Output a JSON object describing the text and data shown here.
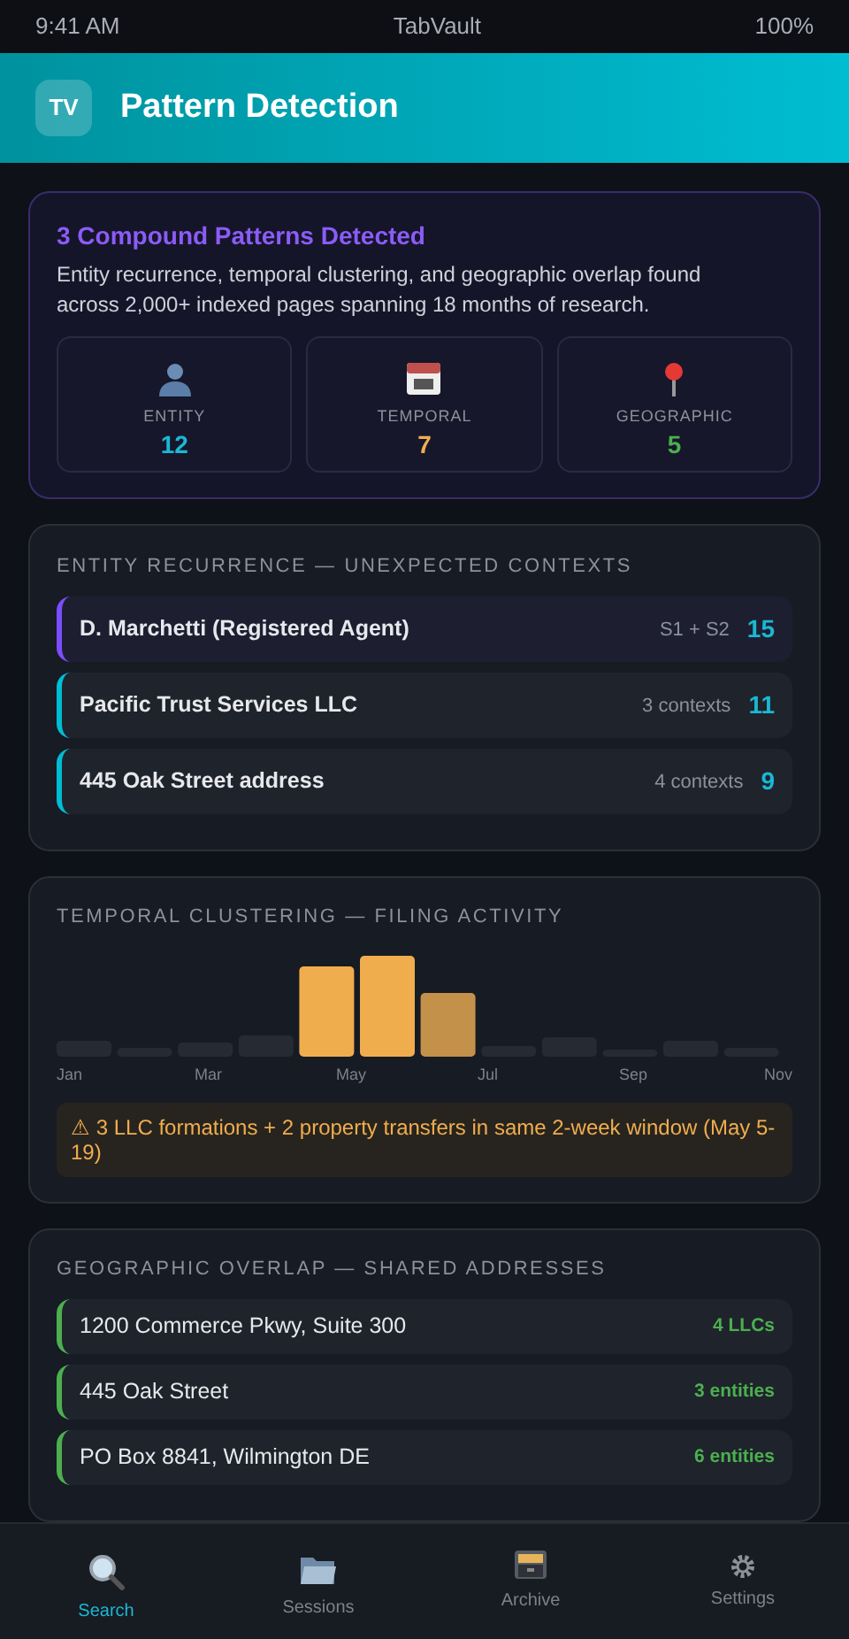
{
  "status_bar": {
    "time": "9:41 AM",
    "app": "TabVault",
    "battery": "100%"
  },
  "header": {
    "logo": "TV",
    "title": "Pattern Detection"
  },
  "summary": {
    "title": "3 Compound Patterns Detected",
    "description": "Entity recurrence, temporal clustering, and geographic overlap found across 2,000+ indexed pages spanning 18 months of research.",
    "stats": [
      {
        "kind": "entity",
        "label": "ENTITY",
        "value": "12",
        "color": "#1ab8d4"
      },
      {
        "kind": "temporal",
        "label": "TEMPORAL",
        "value": "7",
        "color": "#f0ad4e"
      },
      {
        "kind": "geographic",
        "label": "GEOGRAPHIC",
        "value": "5",
        "color": "#4caf50"
      }
    ]
  },
  "entity_recurrence": {
    "title": "ENTITY RECURRENCE — UNEXPECTED CONTEXTS",
    "rows": [
      {
        "name": "D. Marchetti (Registered Agent)",
        "detail": "S1 + S2",
        "count": "15",
        "color": "#7c4dff"
      },
      {
        "name": "Pacific Trust Services LLC",
        "detail": "3 contexts",
        "count": "11",
        "color": "#00bcd4"
      },
      {
        "name": "445 Oak Street address",
        "detail": "4 contexts",
        "count": "9",
        "color": "#00bcd4"
      }
    ]
  },
  "temporal_clustering": {
    "title": "TEMPORAL CLUSTERING — FILING ACTIVITY",
    "axis_labels": [
      "Jan",
      "Mar",
      "May",
      "Jul",
      "Sep",
      "Nov"
    ],
    "alert": "⚠ 3 LLC formations + 2 property transfers in same 2-week window (May 5-19)"
  },
  "geographic_overlap": {
    "title": "GEOGRAPHIC OVERLAP — SHARED ADDRESSES",
    "rows": [
      {
        "address": "1200 Commerce Pkwy, Suite 300",
        "count": "4 LLCs"
      },
      {
        "address": "445 Oak Street",
        "count": "3 entities"
      },
      {
        "address": "PO Box 8841, Wilmington DE",
        "count": "6 entities"
      }
    ]
  },
  "nav": [
    {
      "kind": "search",
      "label": "Search",
      "selected": true
    },
    {
      "kind": "sessions",
      "label": "Sessions",
      "selected": false
    },
    {
      "kind": "archive",
      "label": "Archive",
      "selected": false
    },
    {
      "kind": "settings",
      "label": "Settings",
      "selected": false
    }
  ]
}
